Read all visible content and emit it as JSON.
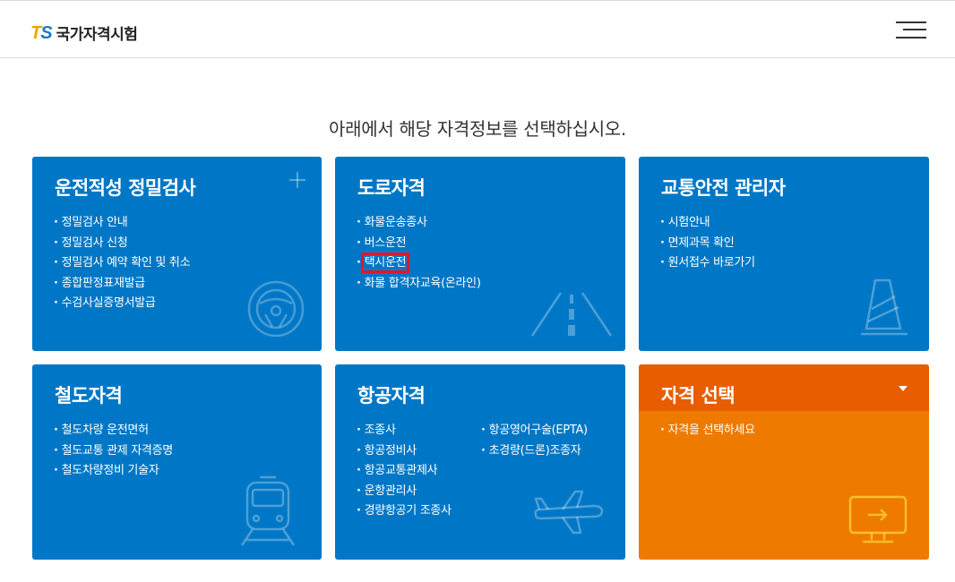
{
  "header": {
    "logo_mark_t": "T",
    "logo_mark_s": "S",
    "logo_text": "국가자격시험",
    "menu_icon": "hamburger-menu-icon"
  },
  "headline": "아래에서 해당 자격정보를 선택하십시오.",
  "cards": {
    "aptitude": {
      "title": "운전적성 정밀검사",
      "items": [
        "정밀검사 안내",
        "정밀검사 신청",
        "정밀검사 예약 확인 및 취소",
        "종합판정표재발급",
        "수검사실증명서발급"
      ],
      "icon": "steering-wheel-icon"
    },
    "road": {
      "title": "도로자격",
      "items": [
        "화물운송종사",
        "버스운전",
        "택시운전",
        "화물 합격자교육(온라인)"
      ],
      "icon": "road-icon"
    },
    "safety": {
      "title": "교통안전 관리자",
      "items": [
        "시험안내",
        "면제과목 확인",
        "원서접수 바로가기"
      ],
      "icon": "traffic-cone-icon"
    },
    "rail": {
      "title": "철도자격",
      "items": [
        "철도차량 운전면허",
        "철도교통 관제 자격증명",
        "철도차량정비 기술자"
      ],
      "icon": "train-icon"
    },
    "aviation": {
      "title": "항공자격",
      "items_col1": [
        "조종사",
        "항공정비사",
        "항공교통관제사",
        "운항관리사",
        "경량항공기 조종사"
      ],
      "items_col2": [
        "항공영어구술(EPTA)",
        "초경량(드론)조종자"
      ],
      "icon": "airplane-icon"
    },
    "select": {
      "title": "자격 선택",
      "items": [
        "자격을 선택하세요"
      ],
      "icon": "monitor-icon"
    }
  },
  "colors": {
    "card_blue": "#0077c6",
    "card_orange": "#ee7a00",
    "select_head": "#e85d00",
    "highlight": "#e8132b",
    "logo_t": "#f2a300",
    "logo_s": "#1b78c8"
  }
}
